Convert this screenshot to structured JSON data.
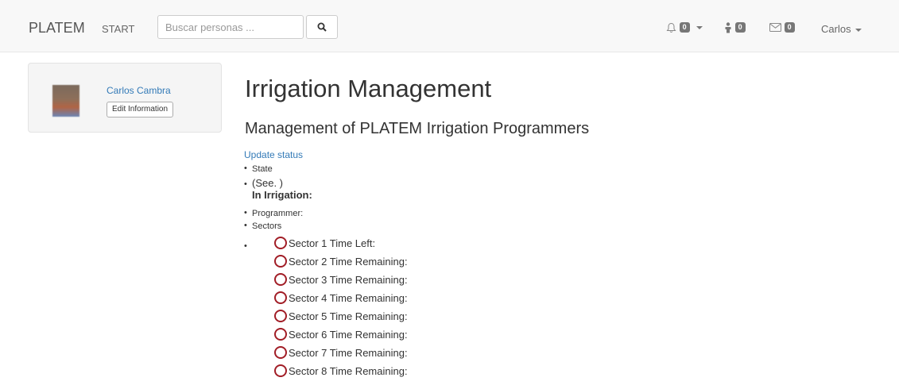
{
  "navbar": {
    "brand": "PLATEM",
    "start_label": "START",
    "search_placeholder": "Buscar personas ...",
    "notifications_count": "0",
    "requests_count": "0",
    "messages_count": "0",
    "user_label": "Carlos",
    "icons": [
      "search-icon",
      "bell-icon",
      "person-icon",
      "envelope-icon"
    ]
  },
  "profile": {
    "name": "Carlos Cambra",
    "edit_label": "Edit Information"
  },
  "main": {
    "title": "Irrigation Management",
    "subtitle": "Management of PLATEM Irrigation Programmers",
    "update_link": "Update status",
    "status": {
      "state_label": "State",
      "see_text": "(See. )",
      "in_irrigation_label": "In Irrigation:",
      "programmer_label": "Programmer:",
      "sectors_label": "Sectors"
    },
    "sectors": [
      "Sector 1 Time Left:",
      "Sector 2 Time Remaining:",
      "Sector 3 Time Remaining:",
      "Sector 4 Time Remaining:",
      "Sector 5 Time Remaining:",
      "Sector 6 Time Remaining:",
      "Sector 7 Time Remaining:",
      "Sector 8 Time Remaining:"
    ],
    "sector_indicator_color": "#a11d26"
  }
}
